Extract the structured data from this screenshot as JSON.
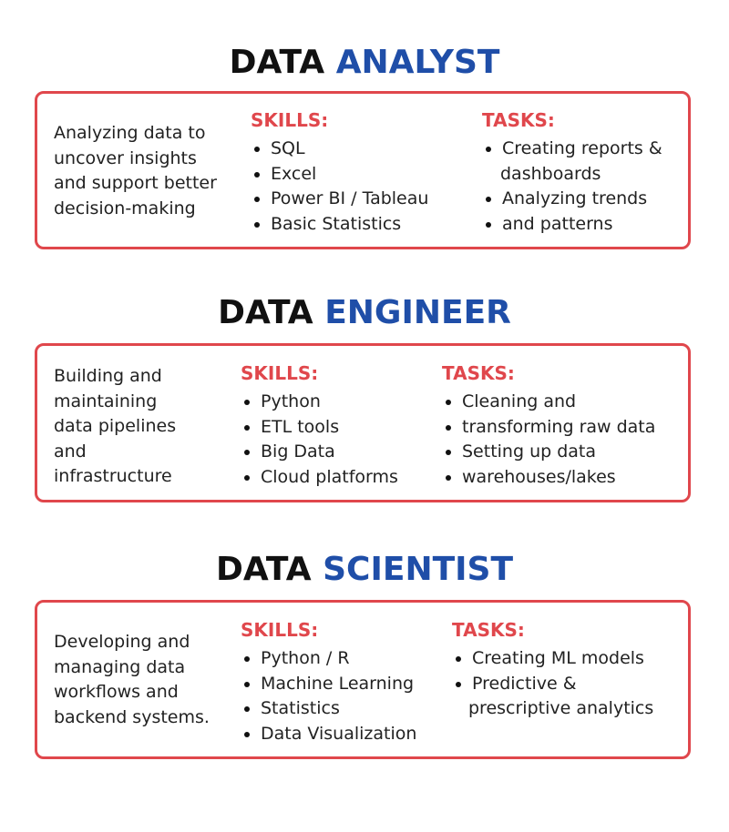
{
  "sections": [
    {
      "title_word1": "DATA",
      "title_word2": "ANALYST",
      "description": [
        "Analyzing data to",
        "uncover insights",
        "and support better",
        "decision-making"
      ],
      "skills_heading": "SKILLS:",
      "skills": [
        "SQL",
        "Excel",
        "Power BI / Tableau",
        "Basic Statistics"
      ],
      "tasks_heading": "TASKS:",
      "tasks": [
        {
          "text": "Creating reports &",
          "bullet": true
        },
        {
          "text": "dashboards",
          "bullet": false
        },
        {
          "text": "Analyzing trends",
          "bullet": true
        },
        {
          "text": "and patterns",
          "bullet": true
        }
      ]
    },
    {
      "title_word1": "DATA",
      "title_word2": "ENGINEER",
      "description": [
        "Building and",
        "maintaining",
        "data pipelines",
        "and",
        "infrastructure"
      ],
      "skills_heading": "SKILLS:",
      "skills": [
        "Python",
        "ETL tools",
        "Big Data",
        "Cloud platforms"
      ],
      "tasks_heading": "TASKS:",
      "tasks": [
        {
          "text": "Cleaning and",
          "bullet": true
        },
        {
          "text": "transforming raw data",
          "bullet": true
        },
        {
          "text": "Setting up data",
          "bullet": true
        },
        {
          "text": "warehouses/lakes",
          "bullet": true
        }
      ]
    },
    {
      "title_word1": "DATA",
      "title_word2": "SCIENTIST",
      "description": [
        "Developing and",
        "managing data",
        "workflows and",
        "backend systems."
      ],
      "skills_heading": "SKILLS:",
      "skills": [
        "Python / R",
        "Machine Learning",
        "Statistics",
        "Data Visualization"
      ],
      "tasks_heading": "TASKS:",
      "tasks": [
        {
          "text": "Creating ML models",
          "bullet": true
        },
        {
          "text": "Predictive &",
          "bullet": true
        },
        {
          "text": "prescriptive analytics",
          "bullet": false
        }
      ]
    }
  ],
  "colors": {
    "accent_red": "#e0474c",
    "title_blue": "#1f4ea8",
    "title_dark": "#111111"
  }
}
